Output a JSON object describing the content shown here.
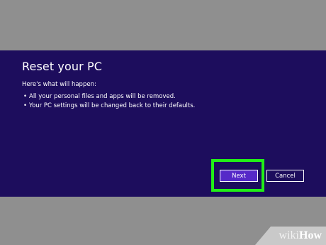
{
  "dialog": {
    "title": "Reset your PC",
    "subtitle": "Here's what will happen:",
    "bullets": [
      "All your personal files and apps will be removed.",
      "Your PC settings will be changed back to their defaults."
    ],
    "bullet_glyph": "•"
  },
  "buttons": {
    "next_label": "Next",
    "cancel_label": "Cancel"
  },
  "watermark": {
    "part1": "wiki",
    "part2": "How"
  },
  "colors": {
    "dialog_bg": "#1d0d5d",
    "next_bg": "#5629c8",
    "highlight": "#22ee17",
    "outer_bg": "#8f8f8f"
  }
}
